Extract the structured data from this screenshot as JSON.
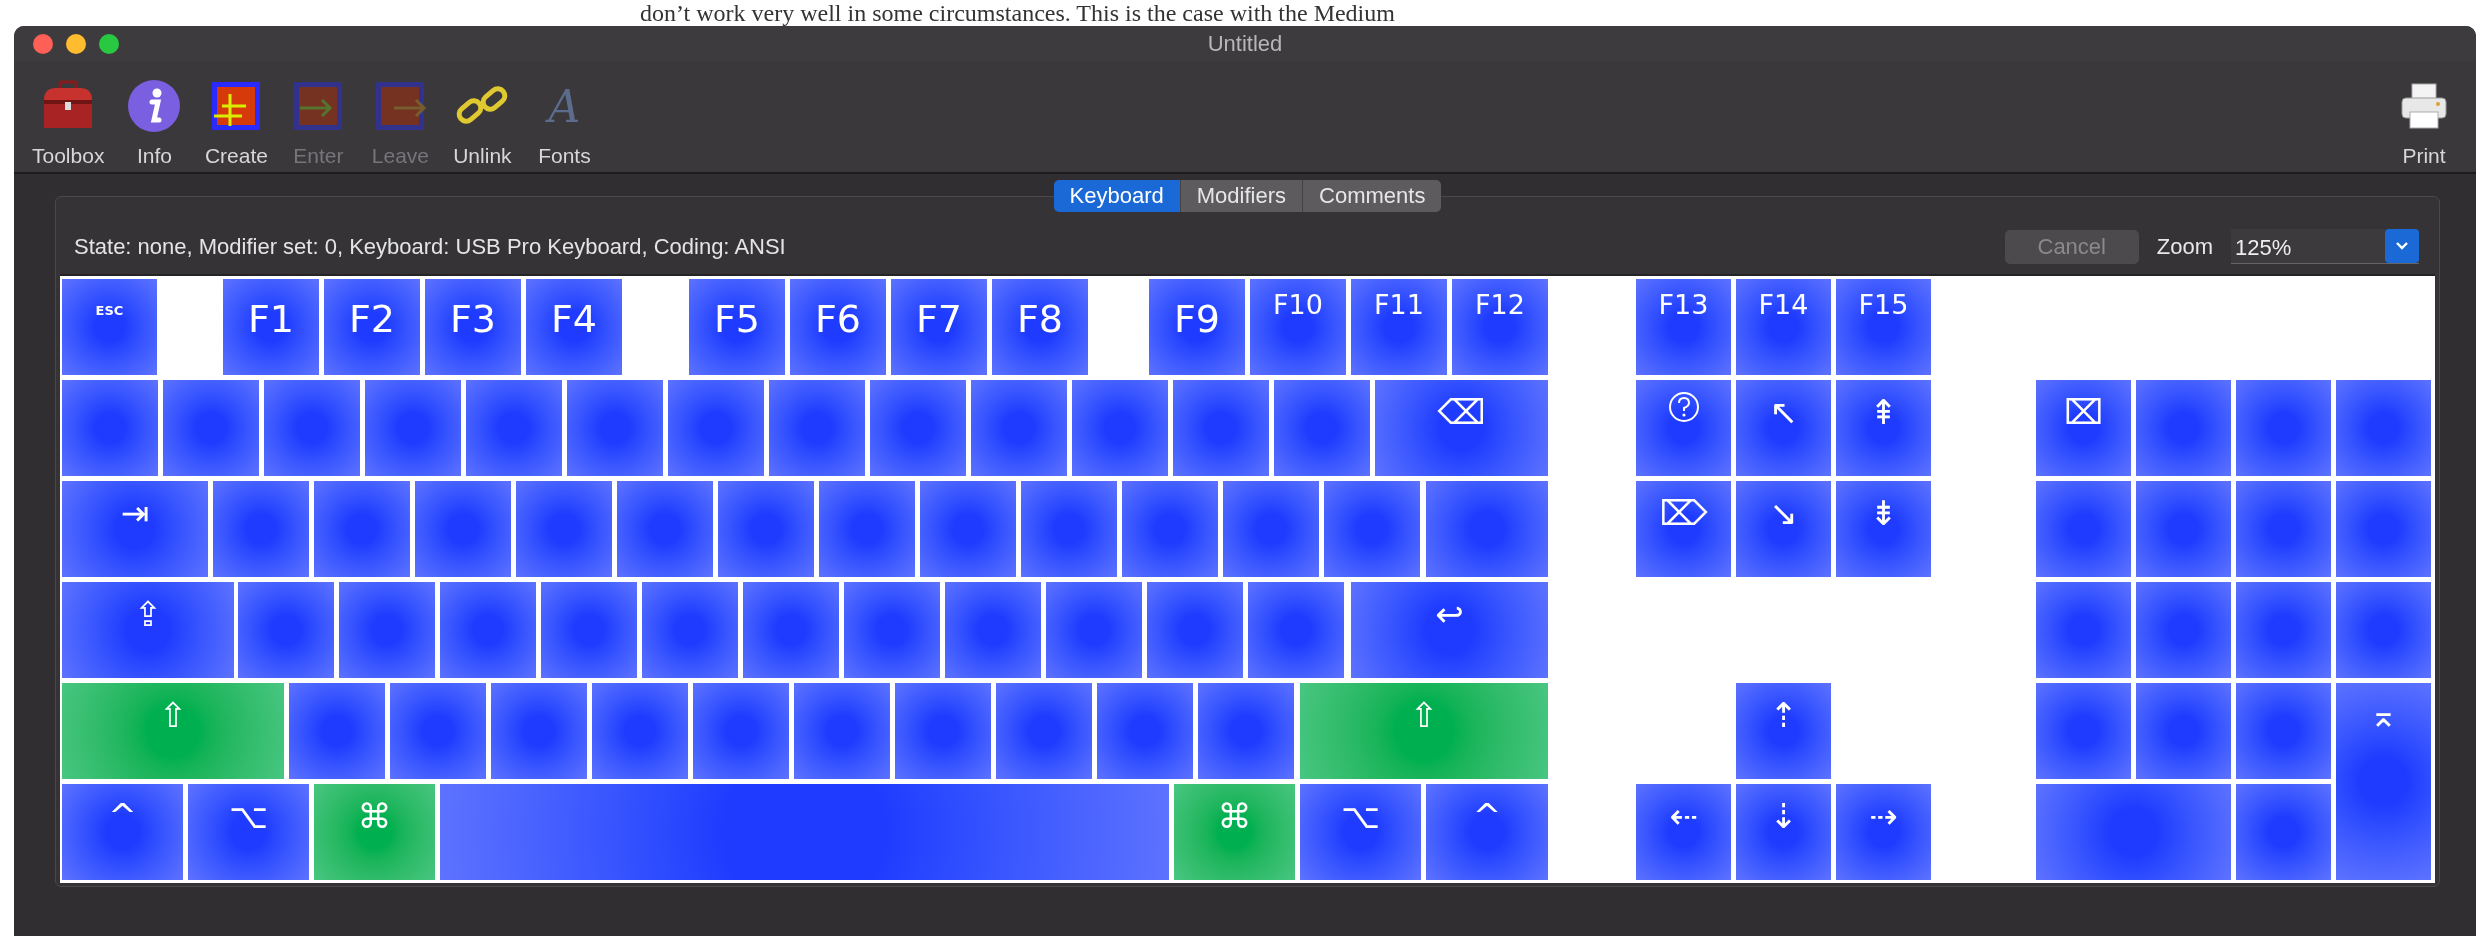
{
  "background_text": "don’t work very well in some circumstances. This is the case with the Medium",
  "window": {
    "title": "Untitled"
  },
  "toolbar": [
    {
      "label": "Toolbox",
      "disabled": false
    },
    {
      "label": "Info",
      "disabled": false
    },
    {
      "label": "Create",
      "disabled": false
    },
    {
      "label": "Enter",
      "disabled": true
    },
    {
      "label": "Leave",
      "disabled": true
    },
    {
      "label": "Unlink",
      "disabled": false
    },
    {
      "label": "Fonts",
      "disabled": false,
      "glyph": "A"
    },
    {
      "label": "Print",
      "disabled": false
    }
  ],
  "tabs": [
    {
      "label": "Keyboard",
      "selected": true
    },
    {
      "label": "Modifiers",
      "selected": false
    },
    {
      "label": "Comments",
      "selected": false
    }
  ],
  "status": "State: none, Modifier set: 0, Keyboard: USB Pro Keyboard, Coding: ANSI",
  "cancel_button": {
    "label": "Cancel",
    "disabled": true
  },
  "zoom": {
    "label": "Zoom",
    "value": "125%"
  },
  "keyboard": {
    "main": [
      [
        {
          "kind": "small-text",
          "label": "ESC",
          "color": "#1f3bff"
        },
        {
          "kind": "text",
          "label": "F1",
          "color": "#1f3bff"
        },
        {
          "kind": "text",
          "label": "F2",
          "color": "#1f3bff"
        },
        {
          "kind": "text",
          "label": "F3",
          "color": "#1f3bff"
        },
        {
          "kind": "text",
          "label": "F4",
          "color": "#1f3bff"
        },
        {
          "kind": "text",
          "label": "F5",
          "color": "#1f3bff"
        },
        {
          "kind": "text",
          "label": "F6",
          "color": "#1f3bff"
        },
        {
          "kind": "text",
          "label": "F7",
          "color": "#1f3bff"
        },
        {
          "kind": "text",
          "label": "F8",
          "color": "#1f3bff"
        },
        {
          "kind": "text",
          "label": "F9",
          "color": "#1f3bff"
        },
        {
          "kind": "mid-text",
          "label": "F10",
          "color": "#1f3bff"
        },
        {
          "kind": "mid-text",
          "label": "F11",
          "color": "#1f3bff"
        },
        {
          "kind": "mid-text",
          "label": "F12",
          "color": "#1f3bff"
        }
      ],
      [
        {
          "kind": "blank",
          "color": "#1f3bff"
        },
        {
          "kind": "blank",
          "color": "#1f3bff"
        },
        {
          "kind": "blank",
          "color": "#1f3bff"
        },
        {
          "kind": "blank",
          "color": "#1f3bff"
        },
        {
          "kind": "blank",
          "color": "#1f3bff"
        },
        {
          "kind": "blank",
          "color": "#1f3bff"
        },
        {
          "kind": "blank",
          "color": "#1f3bff"
        },
        {
          "kind": "blank",
          "color": "#1f3bff"
        },
        {
          "kind": "blank",
          "color": "#1f3bff"
        },
        {
          "kind": "blank",
          "color": "#1f3bff"
        },
        {
          "kind": "blank",
          "color": "#1f3bff"
        },
        {
          "kind": "blank",
          "color": "#1f3bff"
        },
        {
          "kind": "blank",
          "color": "#1f3bff"
        },
        {
          "kind": "symbol",
          "label": "⌫",
          "color": "#1f3bff"
        }
      ],
      [
        {
          "kind": "symbol",
          "label": "⇥",
          "color": "#1f3bff"
        },
        {
          "kind": "blank",
          "color": "#1f3bff"
        },
        {
          "kind": "blank",
          "color": "#1f3bff"
        },
        {
          "kind": "blank",
          "color": "#1f3bff"
        },
        {
          "kind": "blank",
          "color": "#1f3bff"
        },
        {
          "kind": "blank",
          "color": "#1f3bff"
        },
        {
          "kind": "blank",
          "color": "#1f3bff"
        },
        {
          "kind": "blank",
          "color": "#1f3bff"
        },
        {
          "kind": "blank",
          "color": "#1f3bff"
        },
        {
          "kind": "blank",
          "color": "#1f3bff"
        },
        {
          "kind": "blank",
          "color": "#1f3bff"
        },
        {
          "kind": "blank",
          "color": "#1f3bff"
        },
        {
          "kind": "blank",
          "color": "#1f3bff"
        },
        {
          "kind": "blank",
          "color": "#1f3bff"
        }
      ],
      [
        {
          "kind": "symbol",
          "label": "⇪",
          "color": "#1f3bff"
        },
        {
          "kind": "blank",
          "color": "#1f3bff"
        },
        {
          "kind": "blank",
          "color": "#1f3bff"
        },
        {
          "kind": "blank",
          "color": "#1f3bff"
        },
        {
          "kind": "blank",
          "color": "#1f3bff"
        },
        {
          "kind": "blank",
          "color": "#1f3bff"
        },
        {
          "kind": "blank",
          "color": "#1f3bff"
        },
        {
          "kind": "blank",
          "color": "#1f3bff"
        },
        {
          "kind": "blank",
          "color": "#1f3bff"
        },
        {
          "kind": "blank",
          "color": "#1f3bff"
        },
        {
          "kind": "blank",
          "color": "#1f3bff"
        },
        {
          "kind": "blank",
          "color": "#1f3bff"
        },
        {
          "kind": "symbol",
          "label": "↩",
          "color": "#1f3bff"
        }
      ],
      [
        {
          "kind": "symbol",
          "label": "⇧",
          "color": "#00b050"
        },
        {
          "kind": "blank",
          "color": "#1f3bff"
        },
        {
          "kind": "blank",
          "color": "#1f3bff"
        },
        {
          "kind": "blank",
          "color": "#1f3bff"
        },
        {
          "kind": "blank",
          "color": "#1f3bff"
        },
        {
          "kind": "blank",
          "color": "#1f3bff"
        },
        {
          "kind": "blank",
          "color": "#1f3bff"
        },
        {
          "kind": "blank",
          "color": "#1f3bff"
        },
        {
          "kind": "blank",
          "color": "#1f3bff"
        },
        {
          "kind": "blank",
          "color": "#1f3bff"
        },
        {
          "kind": "blank",
          "color": "#1f3bff"
        },
        {
          "kind": "symbol",
          "label": "⇧",
          "color": "#00b050"
        }
      ],
      [
        {
          "kind": "symbol",
          "label": "^",
          "color": "#1f3bff"
        },
        {
          "kind": "symbol",
          "label": "⌥",
          "color": "#1f3bff"
        },
        {
          "kind": "symbol",
          "label": "⌘",
          "color": "#00b050"
        },
        {
          "kind": "blank",
          "color": "#1f3bff"
        },
        {
          "kind": "symbol",
          "label": "⌘",
          "color": "#00b050"
        },
        {
          "kind": "symbol",
          "label": "⌥",
          "color": "#1f3bff"
        },
        {
          "kind": "symbol",
          "label": "^",
          "color": "#1f3bff"
        }
      ]
    ],
    "navigation": [
      [
        {
          "kind": "mid-text",
          "label": "F13",
          "color": "#1f3bff"
        },
        {
          "kind": "mid-text",
          "label": "F14",
          "color": "#1f3bff"
        },
        {
          "kind": "mid-text",
          "label": "F15",
          "color": "#1f3bff"
        }
      ],
      [
        {
          "kind": "help",
          "color": "#1f3bff"
        },
        {
          "kind": "symbol",
          "label": "↖",
          "color": "#1f3bff"
        },
        {
          "kind": "symbol",
          "label": "⇞",
          "color": "#1f3bff"
        }
      ],
      [
        {
          "kind": "symbol",
          "label": "⌦",
          "color": "#1f3bff"
        },
        {
          "kind": "symbol",
          "label": "↘",
          "color": "#1f3bff"
        },
        {
          "kind": "symbol",
          "label": "⇟",
          "color": "#1f3bff"
        }
      ],
      [
        {
          "kind": "symbol",
          "label": "⇡",
          "color": "#1f3bff"
        }
      ],
      [
        {
          "kind": "symbol",
          "label": "⇠",
          "color": "#1f3bff"
        },
        {
          "kind": "symbol",
          "label": "⇣",
          "color": "#1f3bff"
        },
        {
          "kind": "symbol",
          "label": "⇢",
          "color": "#1f3bff"
        }
      ]
    ],
    "numpad": [
      [
        {
          "kind": "symbol",
          "label": "⌧",
          "color": "#1f3bff"
        },
        {
          "kind": "blank",
          "color": "#1f3bff"
        },
        {
          "kind": "blank",
          "color": "#1f3bff"
        },
        {
          "kind": "blank",
          "color": "#1f3bff"
        }
      ],
      [
        {
          "kind": "blank",
          "color": "#1f3bff"
        },
        {
          "kind": "blank",
          "color": "#1f3bff"
        },
        {
          "kind": "blank",
          "color": "#1f3bff"
        },
        {
          "kind": "blank",
          "color": "#1f3bff"
        }
      ],
      [
        {
          "kind": "blank",
          "color": "#1f3bff"
        },
        {
          "kind": "blank",
          "color": "#1f3bff"
        },
        {
          "kind": "blank",
          "color": "#1f3bff"
        },
        {
          "kind": "blank",
          "color": "#1f3bff"
        }
      ],
      [
        {
          "kind": "blank",
          "color": "#1f3bff"
        },
        {
          "kind": "blank",
          "color": "#1f3bff"
        },
        {
          "kind": "blank",
          "color": "#1f3bff"
        },
        {
          "kind": "symbol",
          "label": "⌅",
          "color": "#1f3bff"
        }
      ],
      [
        {
          "kind": "blank",
          "color": "#1f3bff"
        },
        {
          "kind": "blank",
          "color": "#1f3bff"
        }
      ]
    ]
  }
}
